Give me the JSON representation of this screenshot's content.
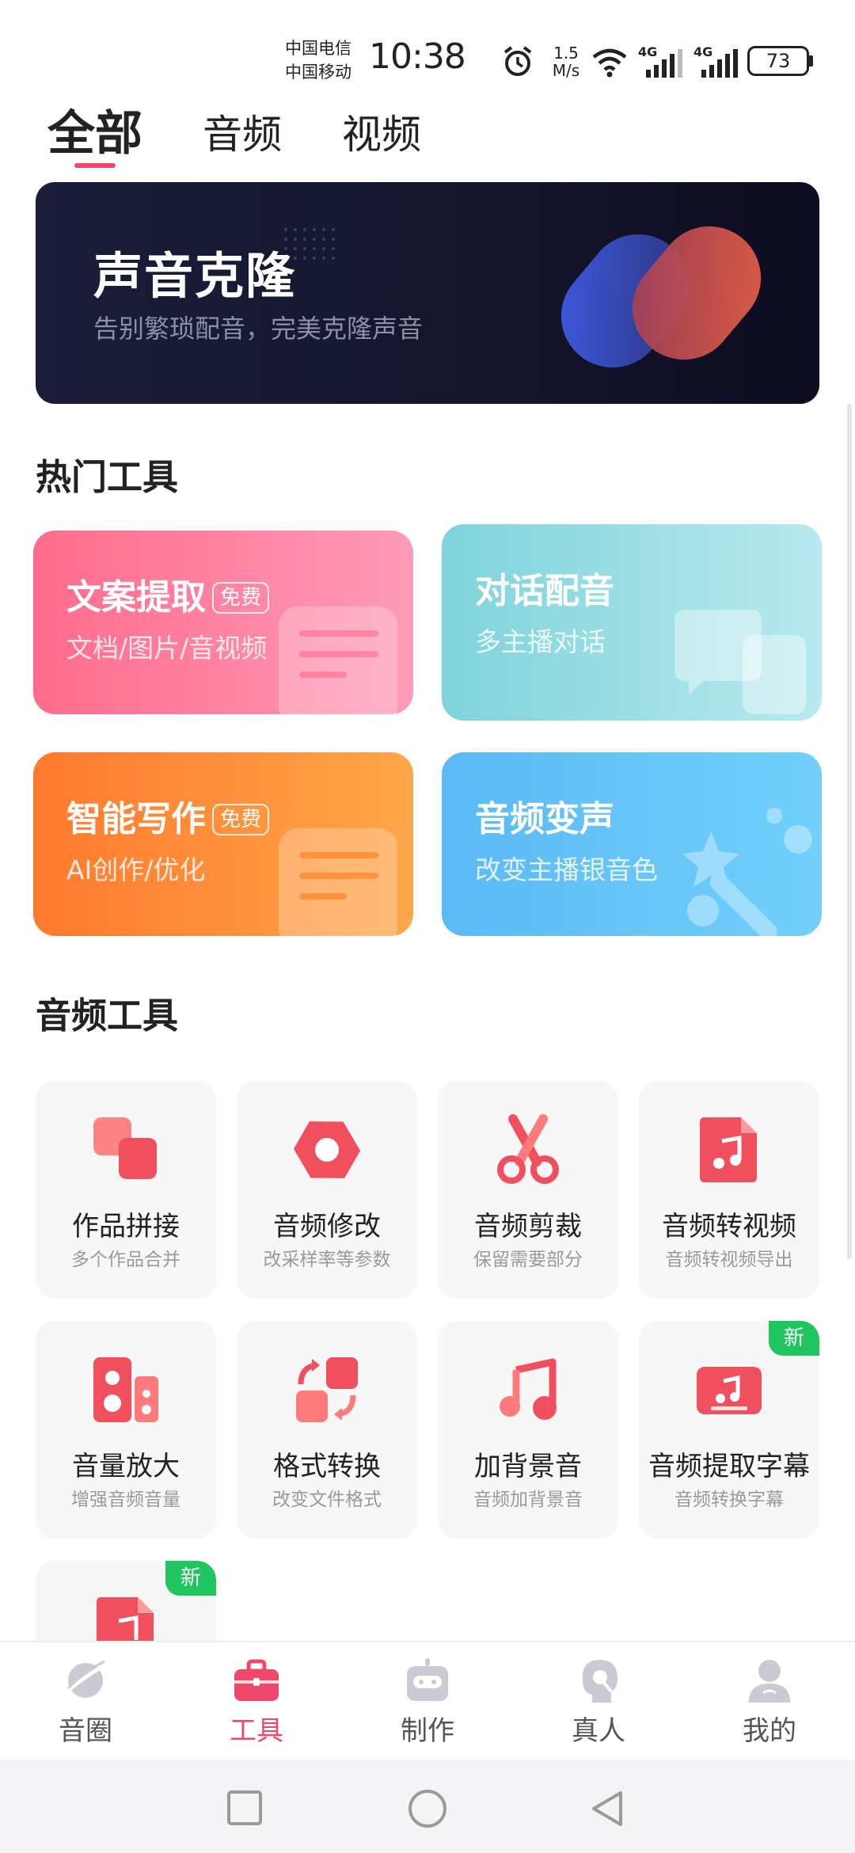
{
  "status_bar": {
    "carrier_1": "中国电信",
    "carrier_2": "中国移动",
    "time": "10:38",
    "speed_value": "1.5",
    "speed_unit": "M/s",
    "net_1": "4G",
    "net_2": "4G",
    "battery": "73"
  },
  "tabs": [
    {
      "label": "全部",
      "active": true
    },
    {
      "label": "音频",
      "active": false
    },
    {
      "label": "视频",
      "active": false
    }
  ],
  "banner": {
    "title": "声音克隆",
    "subtitle": "告别繁琐配音，完美克隆声音"
  },
  "hot_tools": {
    "title": "热门工具",
    "items": [
      {
        "title": "文案提取",
        "badge": "免费",
        "subtitle": "文档/图片/音视频",
        "colors": [
          "#ff6b8c",
          "#ff94b3"
        ]
      },
      {
        "title": "对话配音",
        "badge": "",
        "subtitle": "多主播对话",
        "colors": [
          "#7fd3dc",
          "#b6e9ec"
        ]
      },
      {
        "title": "智能写作",
        "badge": "免费",
        "subtitle": "AI创作/优化",
        "colors": [
          "#ff7a2e",
          "#ffa64a"
        ]
      },
      {
        "title": "音频变声",
        "badge": "",
        "subtitle": "改变主播银音色",
        "colors": [
          "#5bb9f5",
          "#74d1fb"
        ]
      }
    ]
  },
  "audio_tools": {
    "title": "音频工具",
    "items": [
      {
        "name": "作品拼接",
        "desc": "多个作品合并",
        "icon": "merge-icon"
      },
      {
        "name": "音频修改",
        "desc": "改采样率等参数",
        "icon": "hexagon-settings-icon"
      },
      {
        "name": "音频剪裁",
        "desc": "保留需要部分",
        "icon": "scissors-icon"
      },
      {
        "name": "音频转视频",
        "desc": "音频转视频导出",
        "icon": "music-file-icon"
      },
      {
        "name": "音量放大",
        "desc": "增强音频音量",
        "icon": "speaker-icon"
      },
      {
        "name": "格式转换",
        "desc": "改变文件格式",
        "icon": "convert-icon"
      },
      {
        "name": "加背景音",
        "desc": "音频加背景音",
        "icon": "music-note-icon"
      },
      {
        "name": "音频提取字幕",
        "desc": "音频转换字幕",
        "icon": "subtitle-icon",
        "badge": "新"
      },
      {
        "name": "",
        "desc": "",
        "icon": "music-file-icon",
        "badge": "新"
      }
    ]
  },
  "bottom_nav": [
    {
      "label": "音圈",
      "icon": "planet-icon",
      "active": false
    },
    {
      "label": "工具",
      "icon": "toolbox-icon",
      "active": true
    },
    {
      "label": "制作",
      "icon": "robot-icon",
      "active": false
    },
    {
      "label": "真人",
      "icon": "head-mic-icon",
      "active": false
    },
    {
      "label": "我的",
      "icon": "user-icon",
      "active": false
    }
  ],
  "colors": {
    "accent": "#f0486a",
    "new_badge": "#1fc55f"
  }
}
